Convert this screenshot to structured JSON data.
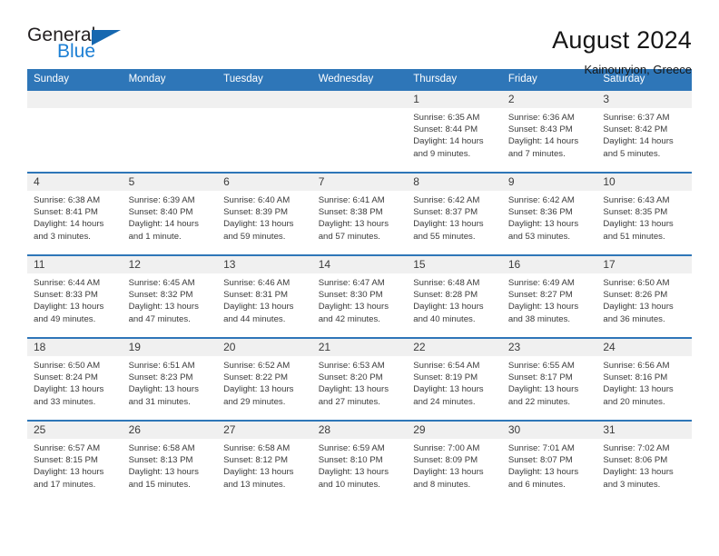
{
  "logo": {
    "word_top": "General",
    "word_bottom": "Blue",
    "triangle_icon": "triangle-icon",
    "accent_color": "#1668b0"
  },
  "header": {
    "title": "August 2024",
    "location": "Kainouryion, Greece"
  },
  "calendar": {
    "header_color": "#2e76b8",
    "daynum_bg": "#f0f0f0",
    "weekday_headers": [
      "Sunday",
      "Monday",
      "Tuesday",
      "Wednesday",
      "Thursday",
      "Friday",
      "Saturday"
    ],
    "weeks": [
      [
        {
          "day": "",
          "lines": []
        },
        {
          "day": "",
          "lines": []
        },
        {
          "day": "",
          "lines": []
        },
        {
          "day": "",
          "lines": []
        },
        {
          "day": "1",
          "lines": [
            "Sunrise: 6:35 AM",
            "Sunset: 8:44 PM",
            "Daylight: 14 hours",
            "and 9 minutes."
          ]
        },
        {
          "day": "2",
          "lines": [
            "Sunrise: 6:36 AM",
            "Sunset: 8:43 PM",
            "Daylight: 14 hours",
            "and 7 minutes."
          ]
        },
        {
          "day": "3",
          "lines": [
            "Sunrise: 6:37 AM",
            "Sunset: 8:42 PM",
            "Daylight: 14 hours",
            "and 5 minutes."
          ]
        }
      ],
      [
        {
          "day": "4",
          "lines": [
            "Sunrise: 6:38 AM",
            "Sunset: 8:41 PM",
            "Daylight: 14 hours",
            "and 3 minutes."
          ]
        },
        {
          "day": "5",
          "lines": [
            "Sunrise: 6:39 AM",
            "Sunset: 8:40 PM",
            "Daylight: 14 hours",
            "and 1 minute."
          ]
        },
        {
          "day": "6",
          "lines": [
            "Sunrise: 6:40 AM",
            "Sunset: 8:39 PM",
            "Daylight: 13 hours",
            "and 59 minutes."
          ]
        },
        {
          "day": "7",
          "lines": [
            "Sunrise: 6:41 AM",
            "Sunset: 8:38 PM",
            "Daylight: 13 hours",
            "and 57 minutes."
          ]
        },
        {
          "day": "8",
          "lines": [
            "Sunrise: 6:42 AM",
            "Sunset: 8:37 PM",
            "Daylight: 13 hours",
            "and 55 minutes."
          ]
        },
        {
          "day": "9",
          "lines": [
            "Sunrise: 6:42 AM",
            "Sunset: 8:36 PM",
            "Daylight: 13 hours",
            "and 53 minutes."
          ]
        },
        {
          "day": "10",
          "lines": [
            "Sunrise: 6:43 AM",
            "Sunset: 8:35 PM",
            "Daylight: 13 hours",
            "and 51 minutes."
          ]
        }
      ],
      [
        {
          "day": "11",
          "lines": [
            "Sunrise: 6:44 AM",
            "Sunset: 8:33 PM",
            "Daylight: 13 hours",
            "and 49 minutes."
          ]
        },
        {
          "day": "12",
          "lines": [
            "Sunrise: 6:45 AM",
            "Sunset: 8:32 PM",
            "Daylight: 13 hours",
            "and 47 minutes."
          ]
        },
        {
          "day": "13",
          "lines": [
            "Sunrise: 6:46 AM",
            "Sunset: 8:31 PM",
            "Daylight: 13 hours",
            "and 44 minutes."
          ]
        },
        {
          "day": "14",
          "lines": [
            "Sunrise: 6:47 AM",
            "Sunset: 8:30 PM",
            "Daylight: 13 hours",
            "and 42 minutes."
          ]
        },
        {
          "day": "15",
          "lines": [
            "Sunrise: 6:48 AM",
            "Sunset: 8:28 PM",
            "Daylight: 13 hours",
            "and 40 minutes."
          ]
        },
        {
          "day": "16",
          "lines": [
            "Sunrise: 6:49 AM",
            "Sunset: 8:27 PM",
            "Daylight: 13 hours",
            "and 38 minutes."
          ]
        },
        {
          "day": "17",
          "lines": [
            "Sunrise: 6:50 AM",
            "Sunset: 8:26 PM",
            "Daylight: 13 hours",
            "and 36 minutes."
          ]
        }
      ],
      [
        {
          "day": "18",
          "lines": [
            "Sunrise: 6:50 AM",
            "Sunset: 8:24 PM",
            "Daylight: 13 hours",
            "and 33 minutes."
          ]
        },
        {
          "day": "19",
          "lines": [
            "Sunrise: 6:51 AM",
            "Sunset: 8:23 PM",
            "Daylight: 13 hours",
            "and 31 minutes."
          ]
        },
        {
          "day": "20",
          "lines": [
            "Sunrise: 6:52 AM",
            "Sunset: 8:22 PM",
            "Daylight: 13 hours",
            "and 29 minutes."
          ]
        },
        {
          "day": "21",
          "lines": [
            "Sunrise: 6:53 AM",
            "Sunset: 8:20 PM",
            "Daylight: 13 hours",
            "and 27 minutes."
          ]
        },
        {
          "day": "22",
          "lines": [
            "Sunrise: 6:54 AM",
            "Sunset: 8:19 PM",
            "Daylight: 13 hours",
            "and 24 minutes."
          ]
        },
        {
          "day": "23",
          "lines": [
            "Sunrise: 6:55 AM",
            "Sunset: 8:17 PM",
            "Daylight: 13 hours",
            "and 22 minutes."
          ]
        },
        {
          "day": "24",
          "lines": [
            "Sunrise: 6:56 AM",
            "Sunset: 8:16 PM",
            "Daylight: 13 hours",
            "and 20 minutes."
          ]
        }
      ],
      [
        {
          "day": "25",
          "lines": [
            "Sunrise: 6:57 AM",
            "Sunset: 8:15 PM",
            "Daylight: 13 hours",
            "and 17 minutes."
          ]
        },
        {
          "day": "26",
          "lines": [
            "Sunrise: 6:58 AM",
            "Sunset: 8:13 PM",
            "Daylight: 13 hours",
            "and 15 minutes."
          ]
        },
        {
          "day": "27",
          "lines": [
            "Sunrise: 6:58 AM",
            "Sunset: 8:12 PM",
            "Daylight: 13 hours",
            "and 13 minutes."
          ]
        },
        {
          "day": "28",
          "lines": [
            "Sunrise: 6:59 AM",
            "Sunset: 8:10 PM",
            "Daylight: 13 hours",
            "and 10 minutes."
          ]
        },
        {
          "day": "29",
          "lines": [
            "Sunrise: 7:00 AM",
            "Sunset: 8:09 PM",
            "Daylight: 13 hours",
            "and 8 minutes."
          ]
        },
        {
          "day": "30",
          "lines": [
            "Sunrise: 7:01 AM",
            "Sunset: 8:07 PM",
            "Daylight: 13 hours",
            "and 6 minutes."
          ]
        },
        {
          "day": "31",
          "lines": [
            "Sunrise: 7:02 AM",
            "Sunset: 8:06 PM",
            "Daylight: 13 hours",
            "and 3 minutes."
          ]
        }
      ]
    ]
  }
}
